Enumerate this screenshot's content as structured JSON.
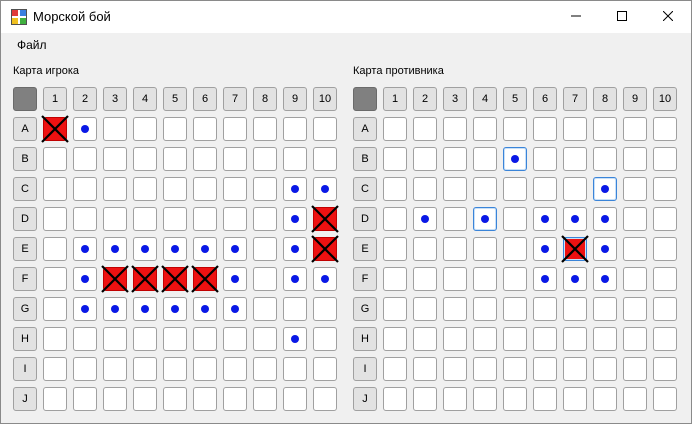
{
  "window": {
    "title": "Морской бой",
    "minimize_glyph": "—",
    "maximize_glyph": "☐",
    "close_glyph": "✕",
    "icon": "battleship-app-icon"
  },
  "menu": {
    "items": [
      {
        "label": "Файл"
      }
    ]
  },
  "boards": {
    "player": {
      "label": "Карта игрока",
      "hits": [
        "A1",
        "D10",
        "E10",
        "F3",
        "F4",
        "F5",
        "F6"
      ],
      "misses": [
        "A2",
        "C9",
        "C10",
        "D9",
        "E2",
        "E3",
        "E4",
        "E5",
        "E6",
        "E7",
        "E9",
        "F2",
        "F7",
        "F9",
        "F10",
        "G2",
        "G3",
        "G4",
        "G5",
        "G6",
        "G7",
        "H9"
      ],
      "highlight": []
    },
    "enemy": {
      "label": "Карта противника",
      "hits": [
        "E7"
      ],
      "misses": [
        "B5",
        "C8",
        "D2",
        "D4",
        "D6",
        "D7",
        "D8",
        "E6",
        "E8",
        "F6",
        "F7",
        "F8"
      ],
      "highlight": [
        "B5",
        "C8",
        "D4",
        "E7"
      ]
    }
  },
  "columns": [
    "1",
    "2",
    "3",
    "4",
    "5",
    "6",
    "7",
    "8",
    "9",
    "10"
  ],
  "rows": [
    "A",
    "B",
    "C",
    "D",
    "E",
    "F",
    "G",
    "H",
    "I",
    "J"
  ],
  "colors": {
    "hit": "#ee1111",
    "miss": "#0a18e6",
    "header_corner": "#808080"
  }
}
